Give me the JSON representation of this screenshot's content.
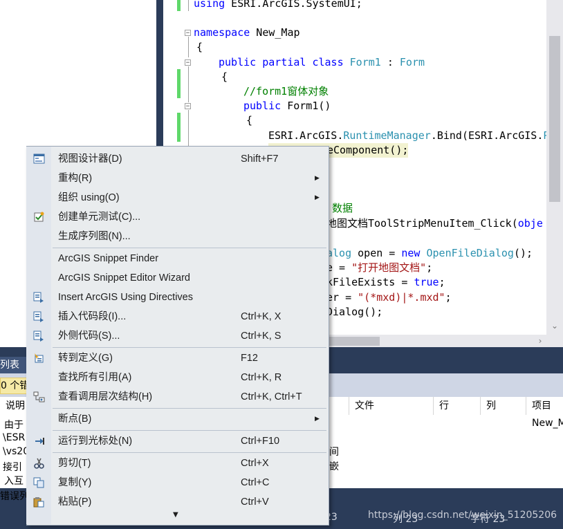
{
  "editor": {
    "lines": {
      "l1": [
        [
          "kw",
          "using"
        ],
        [
          "pl",
          " ESRI.ArcGIS.SystemUI;"
        ]
      ],
      "l2": [
        [
          "kw",
          "namespace"
        ],
        [
          "pl",
          " New_Map"
        ]
      ],
      "l3": [
        [
          "pl",
          "{"
        ]
      ],
      "l4": [
        [
          "kw",
          "public partial class"
        ],
        [
          "pl",
          " "
        ],
        [
          "ty",
          "Form1"
        ],
        [
          "pl",
          " : "
        ],
        [
          "ty",
          "Form"
        ]
      ],
      "l5": [
        [
          "pl",
          "{"
        ]
      ],
      "l6": [
        [
          "cm",
          "//form1窗体对象"
        ]
      ],
      "l7": [
        [
          "kw",
          "public"
        ],
        [
          "pl",
          " Form1()"
        ]
      ],
      "l8": [
        [
          "pl",
          "{"
        ]
      ],
      "l9": [
        [
          "pl",
          "ESRI.ArcGIS."
        ],
        [
          "ty",
          "RuntimeManager"
        ],
        [
          "pl",
          ".Bind(ESRI.ArcGIS."
        ],
        [
          "ty",
          "P"
        ]
      ],
      "l10": [
        [
          "pl",
          "eComponent();"
        ]
      ],
      "l11": [
        [
          "cm",
          "数据"
        ]
      ],
      "l12": [
        [
          "pl",
          "地图文档ToolStripMenuItem_Click("
        ],
        [
          "kw",
          "obje"
        ]
      ],
      "l13": [
        [
          "ty",
          "alog"
        ],
        [
          "pl",
          " open = "
        ],
        [
          "kw",
          "new"
        ],
        [
          "pl",
          " "
        ],
        [
          "ty",
          "OpenFileDialog"
        ],
        [
          "pl",
          "();"
        ]
      ],
      "l14": [
        [
          "pl",
          "e = "
        ],
        [
          "st",
          "\"打开地图文档\""
        ],
        [
          "pl",
          ";"
        ]
      ],
      "l15": [
        [
          "pl",
          "kFileExists = "
        ],
        [
          "kw",
          "true"
        ],
        [
          "pl",
          ";"
        ]
      ],
      "l16": [
        [
          "pl",
          "er = "
        ],
        [
          "st",
          "\"(*mxd)|*.mxd\""
        ],
        [
          "pl",
          ";"
        ]
      ],
      "l17": [
        [
          "pl",
          "Dialog();"
        ]
      ]
    }
  },
  "error_list": {
    "tab_label": "列表",
    "count_label": "0 个错",
    "columns": {
      "desc": "说明",
      "file": "文件",
      "line": "行",
      "col": "列",
      "project": "项目"
    },
    "rows": {
      "r1": "由于",
      "r2": "\\ESR",
      "r3": "\\vs20",
      "r4": "接引",
      "r5": "入互",
      "r6": "错误列",
      "frag1": "间",
      "frag2": "嵌",
      "project1": "New_M"
    }
  },
  "status": {
    "ln": "23",
    "col": "列 23",
    "ch": "字符 23",
    "watermark": "https://blog.csdn.net/weixin_51205206"
  },
  "menu": {
    "view_designer": {
      "label": "视图设计器(D)",
      "shortcut": "Shift+F7",
      "icon": "designer-icon"
    },
    "refactor": {
      "label": "重构(R)"
    },
    "organize_using": {
      "label": "组织 using(O)"
    },
    "create_unit_tests": {
      "label": "创建单元测试(C)...",
      "icon": "unit-test-icon"
    },
    "generate_sequence": {
      "label": "生成序列图(N)..."
    },
    "snippet_finder": {
      "label": "ArcGIS Snippet Finder"
    },
    "snippet_editor": {
      "label": "ArcGIS Snippet Editor Wizard"
    },
    "insert_using": {
      "label": "Insert ArcGIS Using Directives",
      "icon": "insert-using-icon"
    },
    "insert_snippet": {
      "label": "插入代码段(I)...",
      "shortcut": "Ctrl+K, X",
      "icon": "insert-snippet-icon"
    },
    "surround_with": {
      "label": "外侧代码(S)...",
      "shortcut": "Ctrl+K, S",
      "icon": "surround-icon"
    },
    "go_to_definition": {
      "label": "转到定义(G)",
      "shortcut": "F12",
      "icon": "go-to-definition-icon"
    },
    "find_references": {
      "label": "查找所有引用(A)",
      "shortcut": "Ctrl+K, R"
    },
    "call_hierarchy": {
      "label": "查看调用层次结构(H)",
      "shortcut": "Ctrl+K, Ctrl+T",
      "icon": "call-hierarchy-icon"
    },
    "breakpoint": {
      "label": "断点(B)"
    },
    "run_to_cursor": {
      "label": "运行到光标处(N)",
      "shortcut": "Ctrl+F10",
      "icon": "run-to-cursor-icon"
    },
    "cut": {
      "label": "剪切(T)",
      "shortcut": "Ctrl+X",
      "icon": "scissors-icon"
    },
    "copy": {
      "label": "复制(Y)",
      "shortcut": "Ctrl+C",
      "icon": "copy-icon"
    },
    "paste": {
      "label": "粘贴(P)",
      "shortcut": "Ctrl+V",
      "icon": "paste-icon"
    }
  }
}
